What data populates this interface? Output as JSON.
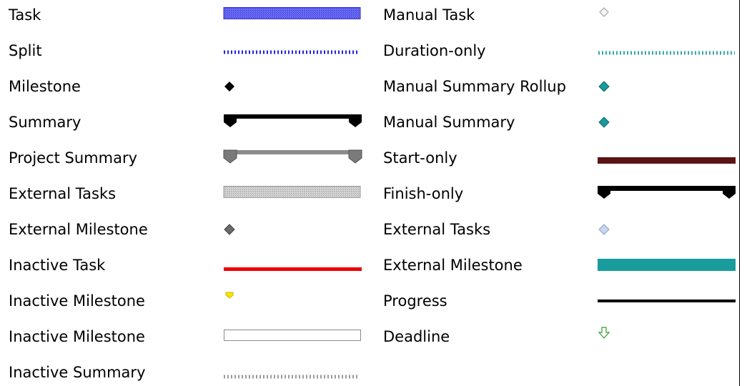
{
  "legend": {
    "left": [
      {
        "label": "Task",
        "symbol": "task-bar"
      },
      {
        "label": "Split",
        "symbol": "split-dots"
      },
      {
        "label": "Milestone",
        "symbol": "milestone-diamond"
      },
      {
        "label": "Summary",
        "symbol": "summary-bar"
      },
      {
        "label": "Project Summary",
        "symbol": "project-summary-bar"
      },
      {
        "label": "External Tasks",
        "symbol": "external-task-bar"
      },
      {
        "label": "External Milestone",
        "symbol": "external-milestone-diamond"
      },
      {
        "label": "Inactive Task",
        "symbol": "inactive-task-line"
      },
      {
        "label": "Inactive Milestone",
        "symbol": "inactive-milestone-marker"
      },
      {
        "label": "Inactive Milestone",
        "symbol": "outline-bar"
      },
      {
        "label": "Inactive Summary",
        "symbol": "inactive-summary-dots"
      }
    ],
    "right": [
      {
        "label": "Manual Task",
        "symbol": "manual-task-diamond"
      },
      {
        "label": "Duration-only",
        "symbol": "duration-only-dots"
      },
      {
        "label": "Manual Summary Rollup",
        "symbol": "manual-summary-rollup-diamond"
      },
      {
        "label": "Manual Summary",
        "symbol": "manual-summary-diamond"
      },
      {
        "label": "Start-only",
        "symbol": "start-only-bar"
      },
      {
        "label": "Finish-only",
        "symbol": "finish-only-bar"
      },
      {
        "label": "External Tasks",
        "symbol": "external-tasks-diamond"
      },
      {
        "label": "External Milestone",
        "symbol": "external-milestone-bar"
      },
      {
        "label": "Progress",
        "symbol": "progress-line"
      },
      {
        "label": "Deadline",
        "symbol": "deadline-arrow-icon"
      }
    ]
  },
  "colors": {
    "task": "#5b5bf0",
    "task_border": "#2a2ad0",
    "split": "#2424e0",
    "summary": "#000000",
    "project_summary": "#8c8c8c",
    "project_summary_cap": "#6e6e6e",
    "external": "#c8c8c8",
    "external_milestone": "#6a6a6a",
    "inactive_task": "#ee0000",
    "inactive_milestone": "#f5e600",
    "inactive_summary": "#9a9a9a",
    "manual_task": "#d8d8d8",
    "duration_only": "#3aa6a6",
    "manual_summary": "#1a9a9a",
    "start_only": "#5a1414",
    "external_tasks_diamond": "#c8d6f0",
    "external_milestone_bar": "#189c9c",
    "progress": "#000000",
    "deadline": "#2e9a2e"
  }
}
